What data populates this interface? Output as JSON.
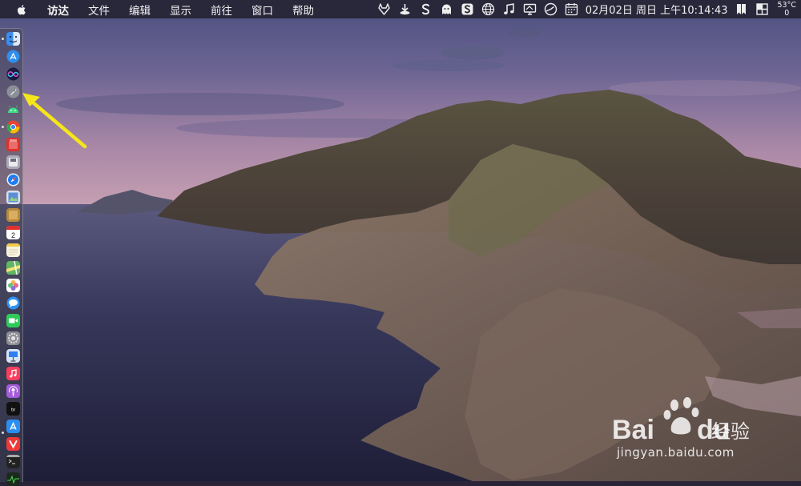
{
  "menubar": {
    "apple_icon": "apple-logo-icon",
    "app_name": "访达",
    "items": [
      "文件",
      "编辑",
      "显示",
      "前往",
      "窗口",
      "帮助"
    ],
    "status_icons": [
      "gitlab-fox-icon",
      "download-tray-icon",
      "s-app-icon",
      "ghost-icon",
      "s-box-icon",
      "globe-icon",
      "music-note-icon",
      "display-icon",
      "clock-dial-icon",
      "calendar-icon"
    ],
    "clock": "02月02日 周日 上午10:14:43",
    "bookmark_icon": "bookmark-icon",
    "cpu_icon": "grid-icon",
    "weather_temp": "53°C",
    "weather_value": "0"
  },
  "dock": {
    "items": [
      {
        "name": "finder-icon",
        "color": "#3a8ef0"
      },
      {
        "name": "app-store-blue-icon",
        "color": "#2f8ff0"
      },
      {
        "name": "siri-icon",
        "color": "#7a4df0"
      },
      {
        "name": "launchpad-rocket-icon",
        "color": "#8a8f98"
      },
      {
        "name": "android-icon",
        "color": "#3ddc84"
      },
      {
        "name": "chrome-icon",
        "color": "#e94335"
      },
      {
        "name": "calendar-red-icon",
        "color": "#e0302c"
      },
      {
        "name": "disk-utility-icon",
        "color": "#a9a9b8"
      },
      {
        "name": "safari-icon",
        "color": "#1e7cf2"
      },
      {
        "name": "preview-icon",
        "color": "#5a8fd6"
      },
      {
        "name": "notes-brown-icon",
        "color": "#b8893a"
      },
      {
        "name": "calendar-icon",
        "color": "#ffffff"
      },
      {
        "name": "notes-icon",
        "color": "#f6f2dc"
      },
      {
        "name": "maps-icon",
        "color": "#62b563"
      },
      {
        "name": "photos-icon",
        "color": "#f3a335"
      },
      {
        "name": "messages-icon",
        "color": "#2f93f5"
      },
      {
        "name": "facetime-icon",
        "color": "#2fcb5a"
      },
      {
        "name": "system-preferences-icon",
        "color": "#8d8d93"
      },
      {
        "name": "keynote-icon",
        "color": "#2f7ff0"
      },
      {
        "name": "music-icon",
        "color": "#fa3f5c"
      },
      {
        "name": "podcasts-icon",
        "color": "#a45bdc"
      },
      {
        "name": "apple-tv-icon",
        "color": "#111111"
      },
      {
        "name": "app-store-icon",
        "color": "#2a8ef0"
      },
      {
        "name": "vivaldi-icon",
        "color": "#ef3939"
      },
      {
        "name": "terminal-icon",
        "color": "#222222"
      },
      {
        "name": "activity-monitor-icon",
        "color": "#1b2a1c"
      }
    ]
  },
  "annotation": {
    "color": "#f5e51b"
  },
  "watermark": {
    "brand": "Bai",
    "brand2": "du",
    "chinese": "经验",
    "url": "jingyan.baidu.com"
  }
}
